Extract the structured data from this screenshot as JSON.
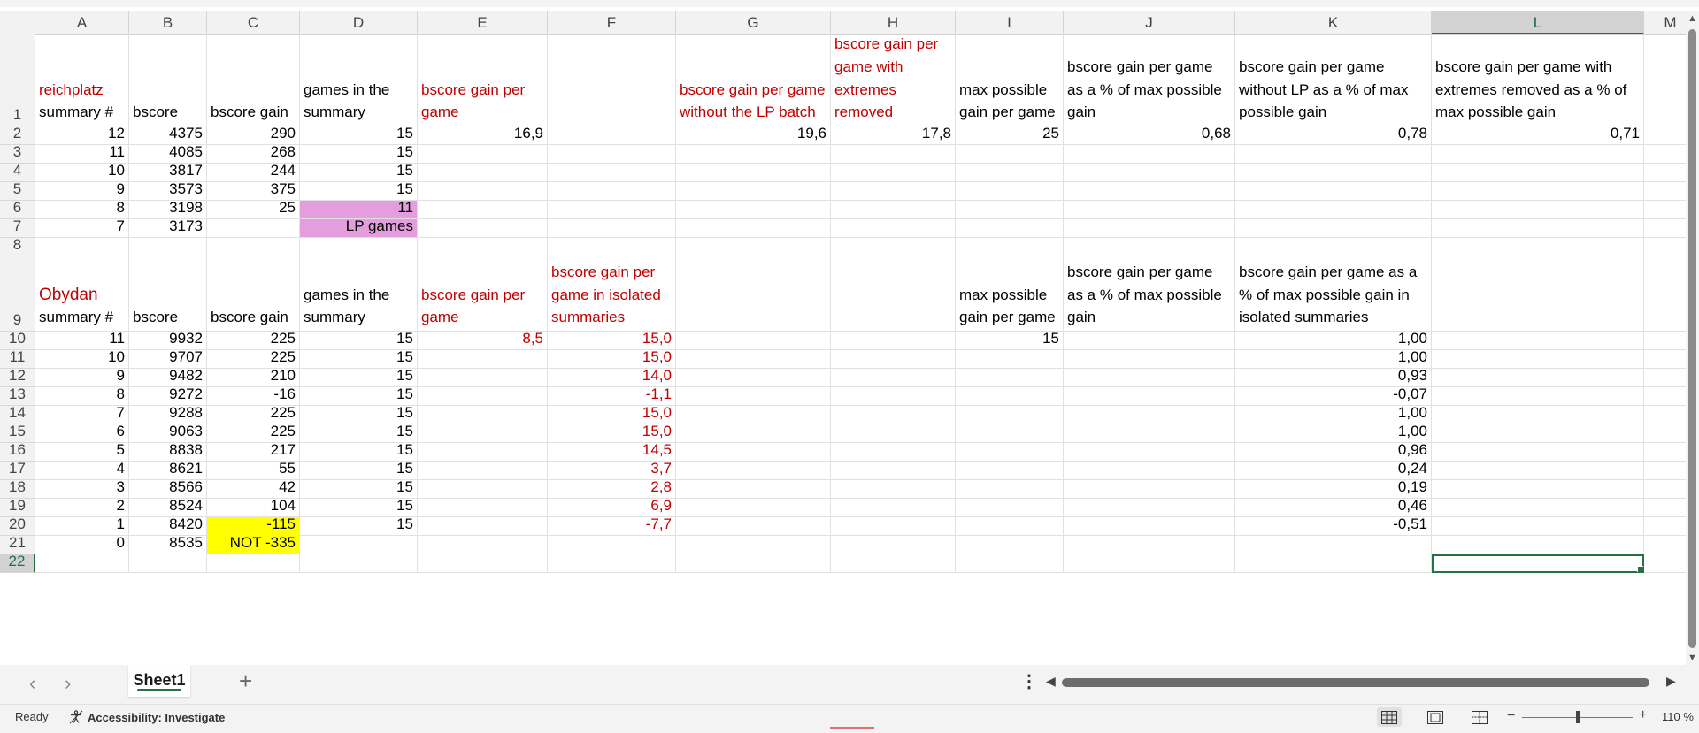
{
  "columns": [
    "A",
    "B",
    "C",
    "D",
    "E",
    "F",
    "G",
    "H",
    "I",
    "J",
    "K",
    "L",
    "M"
  ],
  "rows": [
    "1",
    "2",
    "3",
    "4",
    "5",
    "6",
    "7",
    "8",
    "9",
    "10",
    "11",
    "12",
    "13",
    "14",
    "15",
    "16",
    "17",
    "18",
    "19",
    "20",
    "21",
    "22"
  ],
  "cells": [
    {
      "r": 1,
      "c": "A",
      "v": "reichplatz\nsummary #",
      "red_first_line": true
    },
    {
      "r": 1,
      "c": "B",
      "v": "bscore"
    },
    {
      "r": 1,
      "c": "C",
      "v": "bscore gain"
    },
    {
      "r": 1,
      "c": "D",
      "v": "games in the summary"
    },
    {
      "r": 1,
      "c": "E",
      "v": "bscore gain per game",
      "color": "red"
    },
    {
      "r": 1,
      "c": "G",
      "v": "bscore gain per game without the LP batch",
      "color": "red"
    },
    {
      "r": 1,
      "c": "H",
      "v": "bscore gain per game with extremes removed",
      "color": "red"
    },
    {
      "r": 1,
      "c": "I",
      "v": "max possible gain per game"
    },
    {
      "r": 1,
      "c": "J",
      "v": "bscore gain per game as a % of max possible gain"
    },
    {
      "r": 1,
      "c": "K",
      "v": "bscore gain per game without LP as a % of max possible gain"
    },
    {
      "r": 1,
      "c": "L",
      "v": "bscore gain per game with extremes removed as a % of max possible gain"
    },
    {
      "r": 2,
      "c": "A",
      "v": "12",
      "n": 1
    },
    {
      "r": 2,
      "c": "B",
      "v": "4375",
      "n": 1
    },
    {
      "r": 2,
      "c": "C",
      "v": "290",
      "n": 1
    },
    {
      "r": 2,
      "c": "D",
      "v": "15",
      "n": 1
    },
    {
      "r": 2,
      "c": "E",
      "v": "16,9",
      "n": 1
    },
    {
      "r": 2,
      "c": "G",
      "v": "19,6",
      "n": 1
    },
    {
      "r": 2,
      "c": "H",
      "v": "17,8",
      "n": 1
    },
    {
      "r": 2,
      "c": "I",
      "v": "25",
      "n": 1
    },
    {
      "r": 2,
      "c": "J",
      "v": "0,68",
      "n": 1
    },
    {
      "r": 2,
      "c": "K",
      "v": "0,78",
      "n": 1
    },
    {
      "r": 2,
      "c": "L",
      "v": "0,71",
      "n": 1
    },
    {
      "r": 3,
      "c": "A",
      "v": "11",
      "n": 1
    },
    {
      "r": 3,
      "c": "B",
      "v": "4085",
      "n": 1
    },
    {
      "r": 3,
      "c": "C",
      "v": "268",
      "n": 1
    },
    {
      "r": 3,
      "c": "D",
      "v": "15",
      "n": 1
    },
    {
      "r": 4,
      "c": "A",
      "v": "10",
      "n": 1
    },
    {
      "r": 4,
      "c": "B",
      "v": "3817",
      "n": 1
    },
    {
      "r": 4,
      "c": "C",
      "v": "244",
      "n": 1
    },
    {
      "r": 4,
      "c": "D",
      "v": "15",
      "n": 1
    },
    {
      "r": 5,
      "c": "A",
      "v": "9",
      "n": 1
    },
    {
      "r": 5,
      "c": "B",
      "v": "3573",
      "n": 1
    },
    {
      "r": 5,
      "c": "C",
      "v": "375",
      "n": 1
    },
    {
      "r": 5,
      "c": "D",
      "v": "15",
      "n": 1
    },
    {
      "r": 6,
      "c": "A",
      "v": "8",
      "n": 1
    },
    {
      "r": 6,
      "c": "B",
      "v": "3198",
      "n": 1
    },
    {
      "r": 6,
      "c": "C",
      "v": "25",
      "n": 1
    },
    {
      "r": 6,
      "c": "D",
      "v": "11",
      "n": 1,
      "bg": "pink"
    },
    {
      "r": 7,
      "c": "A",
      "v": "7",
      "n": 1
    },
    {
      "r": 7,
      "c": "B",
      "v": "3173",
      "n": 1
    },
    {
      "r": 7,
      "c": "D",
      "v": "LP games",
      "n": 1,
      "bg": "pink"
    },
    {
      "r": 9,
      "c": "A",
      "v": "Obydan\nsummary #",
      "red_first_line": true,
      "big_first": true
    },
    {
      "r": 9,
      "c": "B",
      "v": "bscore"
    },
    {
      "r": 9,
      "c": "C",
      "v": "bscore gain"
    },
    {
      "r": 9,
      "c": "D",
      "v": "games in the summary"
    },
    {
      "r": 9,
      "c": "E",
      "v": "bscore gain per game",
      "color": "red"
    },
    {
      "r": 9,
      "c": "F",
      "v": "bscore gain per game in isolated summaries",
      "color": "red"
    },
    {
      "r": 9,
      "c": "I",
      "v": "max possible gain per game"
    },
    {
      "r": 9,
      "c": "J",
      "v": "bscore gain per game as a % of max possible gain"
    },
    {
      "r": 9,
      "c": "K",
      "v": "bscore gain per game as a % of max possible gain in isolated summaries"
    },
    {
      "r": 10,
      "c": "A",
      "v": "11",
      "n": 1
    },
    {
      "r": 10,
      "c": "B",
      "v": "9932",
      "n": 1
    },
    {
      "r": 10,
      "c": "C",
      "v": "225",
      "n": 1
    },
    {
      "r": 10,
      "c": "D",
      "v": "15",
      "n": 1
    },
    {
      "r": 10,
      "c": "E",
      "v": "8,5",
      "n": 1,
      "color": "red"
    },
    {
      "r": 10,
      "c": "F",
      "v": "15,0",
      "n": 1,
      "color": "red"
    },
    {
      "r": 10,
      "c": "I",
      "v": "15",
      "n": 1
    },
    {
      "r": 10,
      "c": "K",
      "v": "1,00",
      "n": 1
    },
    {
      "r": 11,
      "c": "A",
      "v": "10",
      "n": 1
    },
    {
      "r": 11,
      "c": "B",
      "v": "9707",
      "n": 1
    },
    {
      "r": 11,
      "c": "C",
      "v": "225",
      "n": 1
    },
    {
      "r": 11,
      "c": "D",
      "v": "15",
      "n": 1
    },
    {
      "r": 11,
      "c": "F",
      "v": "15,0",
      "n": 1,
      "color": "red"
    },
    {
      "r": 11,
      "c": "K",
      "v": "1,00",
      "n": 1
    },
    {
      "r": 12,
      "c": "A",
      "v": "9",
      "n": 1
    },
    {
      "r": 12,
      "c": "B",
      "v": "9482",
      "n": 1
    },
    {
      "r": 12,
      "c": "C",
      "v": "210",
      "n": 1
    },
    {
      "r": 12,
      "c": "D",
      "v": "15",
      "n": 1
    },
    {
      "r": 12,
      "c": "F",
      "v": "14,0",
      "n": 1,
      "color": "red"
    },
    {
      "r": 12,
      "c": "K",
      "v": "0,93",
      "n": 1
    },
    {
      "r": 13,
      "c": "A",
      "v": "8",
      "n": 1
    },
    {
      "r": 13,
      "c": "B",
      "v": "9272",
      "n": 1
    },
    {
      "r": 13,
      "c": "C",
      "v": "-16",
      "n": 1
    },
    {
      "r": 13,
      "c": "D",
      "v": "15",
      "n": 1
    },
    {
      "r": 13,
      "c": "F",
      "v": "-1,1",
      "n": 1,
      "color": "red"
    },
    {
      "r": 13,
      "c": "K",
      "v": "-0,07",
      "n": 1
    },
    {
      "r": 14,
      "c": "A",
      "v": "7",
      "n": 1
    },
    {
      "r": 14,
      "c": "B",
      "v": "9288",
      "n": 1
    },
    {
      "r": 14,
      "c": "C",
      "v": "225",
      "n": 1
    },
    {
      "r": 14,
      "c": "D",
      "v": "15",
      "n": 1
    },
    {
      "r": 14,
      "c": "F",
      "v": "15,0",
      "n": 1,
      "color": "red"
    },
    {
      "r": 14,
      "c": "K",
      "v": "1,00",
      "n": 1
    },
    {
      "r": 15,
      "c": "A",
      "v": "6",
      "n": 1
    },
    {
      "r": 15,
      "c": "B",
      "v": "9063",
      "n": 1
    },
    {
      "r": 15,
      "c": "C",
      "v": "225",
      "n": 1
    },
    {
      "r": 15,
      "c": "D",
      "v": "15",
      "n": 1
    },
    {
      "r": 15,
      "c": "F",
      "v": "15,0",
      "n": 1,
      "color": "red"
    },
    {
      "r": 15,
      "c": "K",
      "v": "1,00",
      "n": 1
    },
    {
      "r": 16,
      "c": "A",
      "v": "5",
      "n": 1
    },
    {
      "r": 16,
      "c": "B",
      "v": "8838",
      "n": 1
    },
    {
      "r": 16,
      "c": "C",
      "v": "217",
      "n": 1
    },
    {
      "r": 16,
      "c": "D",
      "v": "15",
      "n": 1
    },
    {
      "r": 16,
      "c": "F",
      "v": "14,5",
      "n": 1,
      "color": "red"
    },
    {
      "r": 16,
      "c": "K",
      "v": "0,96",
      "n": 1
    },
    {
      "r": 17,
      "c": "A",
      "v": "4",
      "n": 1
    },
    {
      "r": 17,
      "c": "B",
      "v": "8621",
      "n": 1
    },
    {
      "r": 17,
      "c": "C",
      "v": "55",
      "n": 1
    },
    {
      "r": 17,
      "c": "D",
      "v": "15",
      "n": 1
    },
    {
      "r": 17,
      "c": "F",
      "v": "3,7",
      "n": 1,
      "color": "red"
    },
    {
      "r": 17,
      "c": "K",
      "v": "0,24",
      "n": 1
    },
    {
      "r": 18,
      "c": "A",
      "v": "3",
      "n": 1
    },
    {
      "r": 18,
      "c": "B",
      "v": "8566",
      "n": 1
    },
    {
      "r": 18,
      "c": "C",
      "v": "42",
      "n": 1
    },
    {
      "r": 18,
      "c": "D",
      "v": "15",
      "n": 1
    },
    {
      "r": 18,
      "c": "F",
      "v": "2,8",
      "n": 1,
      "color": "red"
    },
    {
      "r": 18,
      "c": "K",
      "v": "0,19",
      "n": 1
    },
    {
      "r": 19,
      "c": "A",
      "v": "2",
      "n": 1
    },
    {
      "r": 19,
      "c": "B",
      "v": "8524",
      "n": 1
    },
    {
      "r": 19,
      "c": "C",
      "v": "104",
      "n": 1
    },
    {
      "r": 19,
      "c": "D",
      "v": "15",
      "n": 1
    },
    {
      "r": 19,
      "c": "F",
      "v": "6,9",
      "n": 1,
      "color": "red"
    },
    {
      "r": 19,
      "c": "K",
      "v": "0,46",
      "n": 1
    },
    {
      "r": 20,
      "c": "A",
      "v": "1",
      "n": 1
    },
    {
      "r": 20,
      "c": "B",
      "v": "8420",
      "n": 1
    },
    {
      "r": 20,
      "c": "C",
      "v": "-115",
      "n": 1,
      "bg": "yellow"
    },
    {
      "r": 20,
      "c": "D",
      "v": "15",
      "n": 1
    },
    {
      "r": 20,
      "c": "F",
      "v": "-7,7",
      "n": 1,
      "color": "red"
    },
    {
      "r": 20,
      "c": "K",
      "v": "-0,51",
      "n": 1
    },
    {
      "r": 21,
      "c": "A",
      "v": "0",
      "n": 1
    },
    {
      "r": 21,
      "c": "B",
      "v": "8535",
      "n": 1
    },
    {
      "r": 21,
      "c": "C",
      "v": "NOT -335",
      "n": 1,
      "bg": "yellow"
    }
  ],
  "active_cell": {
    "r": 22,
    "c": "L"
  },
  "sheet_tab": "Sheet1",
  "add_sheet": "+",
  "status": {
    "ready": "Ready",
    "accessibility": "Accessibility: Investigate",
    "zoom": "110 %"
  },
  "colors": {
    "accent": "#217346",
    "red": "#c00000",
    "pink": "#e59edd",
    "yellow": "#ffff00"
  }
}
